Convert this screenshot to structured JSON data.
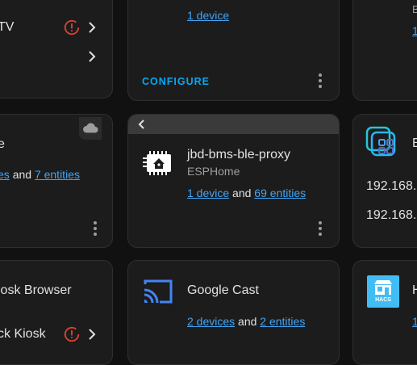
{
  "cards": {
    "tv": {
      "name_fragment": "TV"
    },
    "cloud_card": {
      "name_fragment": "e",
      "links_prefix": "es",
      "and_text": "and",
      "entities_link": "7 entities"
    },
    "configure_card": {
      "devices_link": "1 device",
      "configure_label": "CONFIGURE"
    },
    "right_top": {
      "fragment": "B",
      "link_fragment": "1"
    },
    "esphome_card": {
      "title": "jbd-bms-ble-proxy",
      "subtitle": "ESPHome",
      "devices_link": "1 device",
      "and_text": "and",
      "entities_link": "69 entities"
    },
    "ip_card": {
      "fragment": "E",
      "ip_line_1": "192.168.",
      "ip_line_2": "192.168."
    },
    "kiosk_card": {
      "name_fragment": "iosk Browser",
      "sub_fragment": "ck Kiosk"
    },
    "google_cast_card": {
      "title": "Google Cast",
      "devices_link": "2 devices",
      "and_text": "and",
      "entities_link": "2 entities"
    },
    "hacs_card": {
      "logo_text": "HACS",
      "fragment": "H",
      "link_fragment": "1"
    }
  },
  "colors": {
    "background": "#111111",
    "card": "#1c1c1c",
    "link": "#42a5f5",
    "accent": "#03a9f4",
    "error": "#db4437"
  }
}
